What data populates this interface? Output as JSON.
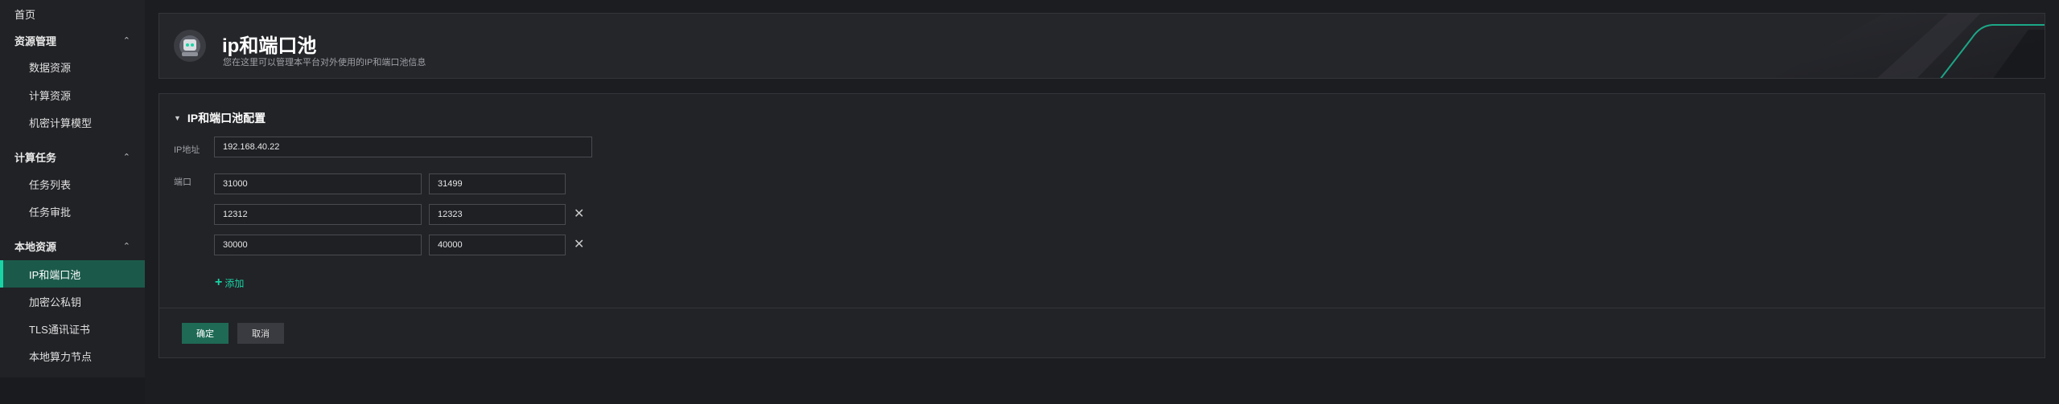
{
  "sidebar": {
    "home": "首页",
    "groups": [
      {
        "label": "资源管理",
        "items": [
          "数据资源",
          "计算资源",
          "机密计算模型"
        ]
      },
      {
        "label": "计算任务",
        "items": [
          "任务列表",
          "任务审批"
        ]
      },
      {
        "label": "本地资源",
        "items": [
          "IP和端口池",
          "加密公私钥",
          "TLS通讯证书",
          "本地算力节点"
        ]
      }
    ],
    "active_item": "IP和端口池",
    "chevron": "⌃"
  },
  "header": {
    "title": "ip和端口池",
    "subtitle": "您在这里可以管理本平台对外使用的IP和端口池信息",
    "logo_icon": "gear-robot-icon"
  },
  "config": {
    "section_title": "IP和端口池配置",
    "ip_label": "IP地址",
    "ip_value": "192.168.40.22",
    "port_label": "端口",
    "port_ranges": [
      {
        "start": "31000",
        "end": "31499",
        "removable": false
      },
      {
        "start": "12312",
        "end": "12323",
        "removable": true
      },
      {
        "start": "30000",
        "end": "40000",
        "removable": true
      }
    ],
    "add_label": "添加",
    "confirm_label": "确定",
    "cancel_label": "取消"
  },
  "colors": {
    "accent": "#19d3a5",
    "active_bg": "#1b5a4a",
    "primary_button": "#1e6a55",
    "background": "#1c1d20"
  }
}
